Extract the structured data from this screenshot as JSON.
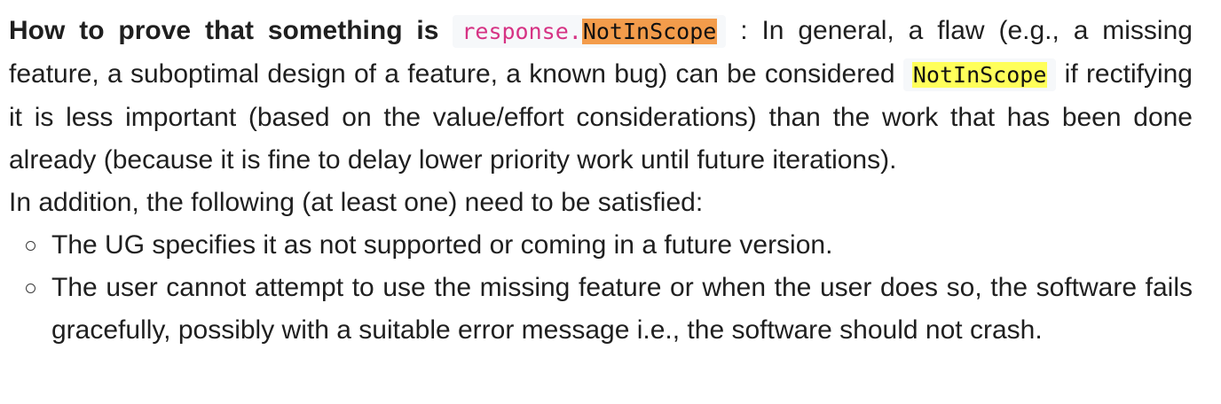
{
  "lead": "How to prove that something is",
  "code1": {
    "prefix": "response.",
    "highlight": "NotInScope"
  },
  "sentence1": ": In general, a flaw (e.g., a missing feature, a suboptimal design of a feature, a known bug) can be considered",
  "code2": "NotInScope",
  "sentence2": "if rectifying it is less important (based on the value/effort considerations) than the work that has been done already (because it is fine to delay lower priority work until future iterations).",
  "requirement_intro": "In addition, the following (at least one) need to be satisfied:",
  "bullets": [
    "The UG specifies it as not supported or coming in a future version.",
    "The user cannot attempt to use the missing feature or when the user does so, the software fails gracefully, possibly with a suitable error message i.e., the software should not crash."
  ],
  "colors": {
    "code_text": "#d63384",
    "highlight_orange": "#f39c4b",
    "highlight_yellow": "#ffff5a",
    "code_background": "#f6f8fa"
  },
  "icons": {
    "bullet": "hollow-circle-bullet-icon"
  }
}
